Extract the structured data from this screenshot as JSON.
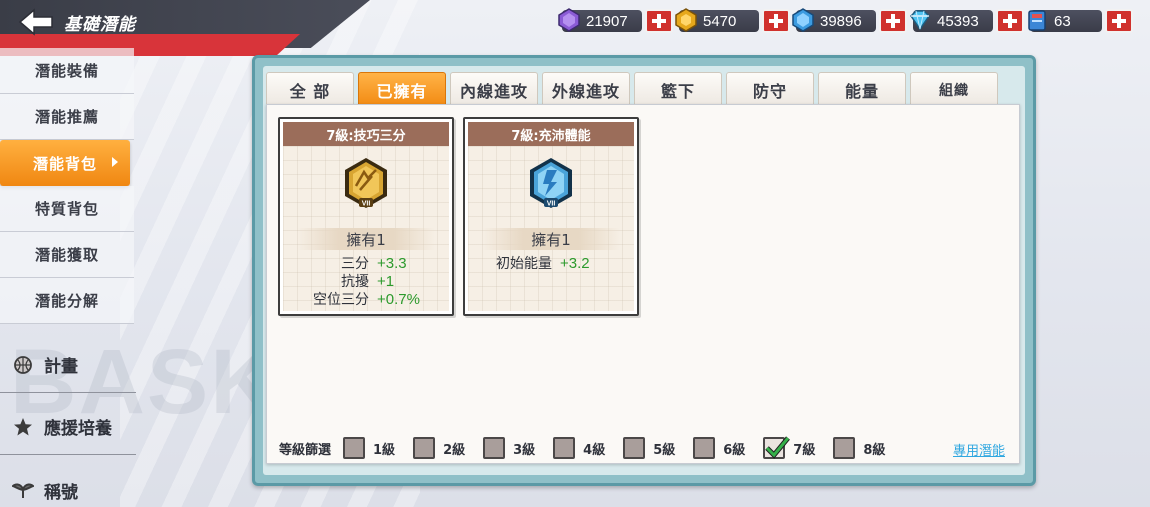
{
  "header": {
    "title": "基礎潛能"
  },
  "currencies": [
    {
      "icon": "purple-gem-icon",
      "value": "21907"
    },
    {
      "icon": "gold-coin-icon",
      "value": "5470"
    },
    {
      "icon": "blue-crystal-icon",
      "value": "39896"
    },
    {
      "icon": "diamond-icon",
      "value": "45393"
    },
    {
      "icon": "book-icon",
      "value": "63"
    }
  ],
  "sidebar": {
    "items": [
      {
        "label": "潛能裝備"
      },
      {
        "label": "潛能推薦"
      },
      {
        "label": "潛能背包"
      },
      {
        "label": "特質背包"
      },
      {
        "label": "潛能獲取"
      },
      {
        "label": "潛能分解"
      }
    ],
    "active_index": 2,
    "sections": [
      {
        "icon": "basketball-icon",
        "label": "計畫"
      },
      {
        "icon": "star-icon",
        "label": "應援培養"
      },
      {
        "icon": "wings-icon",
        "label": "稱號"
      }
    ]
  },
  "background": {
    "word": "BASKET"
  },
  "tabs": [
    "全 部",
    "已擁有",
    "內線進攻",
    "外線進攻",
    "籃下",
    "防守",
    "能量",
    "組織"
  ],
  "active_tab": 1,
  "cards": [
    {
      "title": "7級:技巧三分",
      "badge": "gold-three-point-badge-icon",
      "badge_color": "#d8a532",
      "owned": "擁有1",
      "stats": [
        {
          "name": "三分",
          "value": "+3.3"
        },
        {
          "name": "抗擾",
          "value": "+1"
        },
        {
          "name": "空位三分",
          "value": "+0.7%"
        }
      ]
    },
    {
      "title": "7級:充沛體能",
      "badge": "blue-energy-badge-icon",
      "badge_color": "#4aa3d9",
      "owned": "擁有1",
      "stats": [
        {
          "name": "初始能量",
          "value": "+3.2"
        }
      ]
    }
  ],
  "filter": {
    "label": "等級篩選",
    "levels": [
      {
        "label": "1級",
        "checked": false
      },
      {
        "label": "2級",
        "checked": false
      },
      {
        "label": "3級",
        "checked": false
      },
      {
        "label": "4級",
        "checked": false
      },
      {
        "label": "5級",
        "checked": false
      },
      {
        "label": "6級",
        "checked": false
      },
      {
        "label": "7級",
        "checked": true
      },
      {
        "label": "8級",
        "checked": false
      }
    ],
    "exclusive_link": "專用潛能"
  },
  "colors": {
    "accent_orange": "#f28a12",
    "plus_red": "#d0312d",
    "stat_green": "#2d9a2d",
    "link_blue": "#2fa7e0"
  }
}
